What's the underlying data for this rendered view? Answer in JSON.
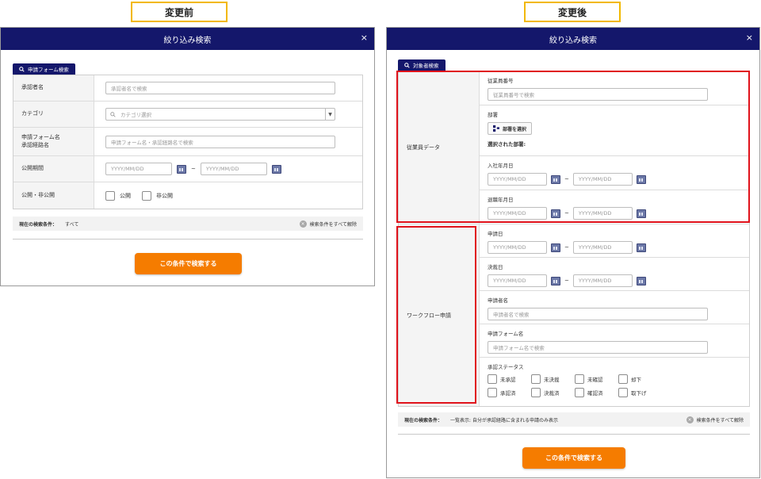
{
  "before": {
    "label": "変更前",
    "title": "絞り込み検索",
    "close": "×",
    "tab": "申請フォーム検索",
    "rows": {
      "approver": {
        "label": "承認者名",
        "placeholder": "承認者名で検索"
      },
      "category": {
        "label": "カテゴリ",
        "placeholder": "カテゴリ選択"
      },
      "form_name": {
        "label": "申請フォーム名\n承認経路名",
        "placeholder": "申請フォーム名・承認経路名で検索"
      },
      "period": {
        "label": "公開期間",
        "from": "YYYY/MM/DD",
        "tilde": "~",
        "to": "YYYY/MM/DD"
      },
      "visibility": {
        "label": "公開・非公開",
        "opt1": "公開",
        "opt2": "非公開"
      }
    },
    "status": {
      "label": "現在の検索条件：",
      "value": "すべて",
      "clear": "検索条件をすべて解除"
    },
    "search_button": "この条件で検索する"
  },
  "after": {
    "label": "変更後",
    "title": "絞り込み検索",
    "close": "×",
    "tab": "対象者検索",
    "employee": {
      "section_label": "従業員データ",
      "emp_no": {
        "label": "従業員番号",
        "placeholder": "従業員番号で検索"
      },
      "dept": {
        "label": "部署",
        "button": "部署を選択",
        "selected": "選択された部署:"
      },
      "join": {
        "label": "入社年月日",
        "from": "YYYY/MM/DD",
        "tilde": "~",
        "to": "YYYY/MM/DD"
      },
      "leave": {
        "label": "退職年月日",
        "from": "YYYY/MM/DD",
        "tilde": "~",
        "to": "YYYY/MM/DD"
      }
    },
    "workflow": {
      "section_label": "ワークフロー申請",
      "apply_date": {
        "label": "申請日",
        "from": "YYYY/MM/DD",
        "tilde": "~",
        "to": "YYYY/MM/DD"
      },
      "decision_date": {
        "label": "決裁日",
        "from": "YYYY/MM/DD",
        "tilde": "~",
        "to": "YYYY/MM/DD"
      },
      "applicant": {
        "label": "申請者名",
        "placeholder": "申請者名で検索"
      },
      "form": {
        "label": "申請フォーム名",
        "placeholder": "申請フォーム名で検索"
      },
      "status": {
        "label": "承認ステータス",
        "options": [
          "未承認",
          "未決裁",
          "未確認",
          "却下",
          "承認済",
          "決裁済",
          "確認済",
          "取下げ"
        ]
      }
    },
    "status": {
      "label": "現在の検索条件：",
      "value": "一覧表示: 自分が承認経路に含まれる申請のみ表示",
      "clear": "検索条件をすべて解除"
    },
    "search_button": "この条件で検索する"
  },
  "colors": {
    "header": "#14176b",
    "accent": "#f57c00",
    "highlight": "#e0121b",
    "label_border": "#f2b800"
  }
}
